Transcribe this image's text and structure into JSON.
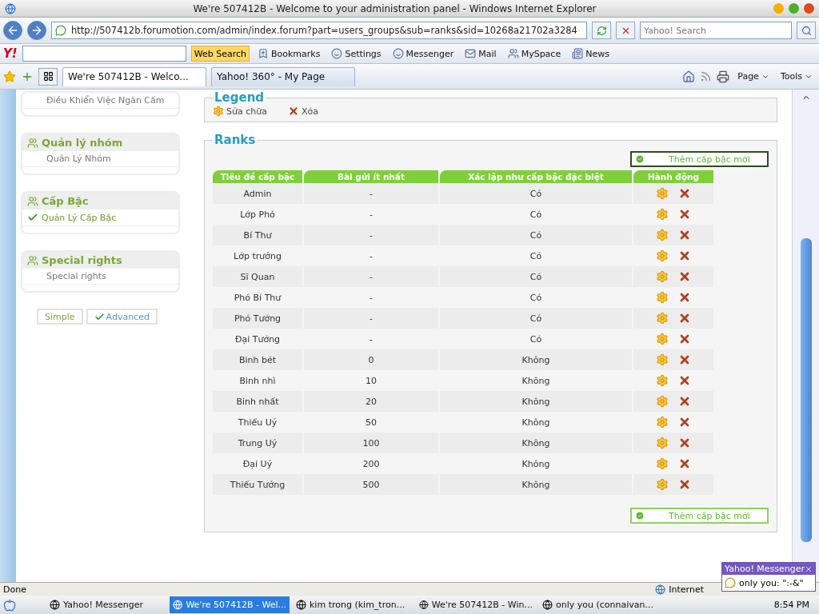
{
  "window": {
    "title": "We're 507412B - Welcome to your administration panel - Windows Internet Explorer"
  },
  "address_bar": {
    "url": "http://507412b.forumotion.com/admin/index.forum?part=users_groups&sub=ranks&sid=10268a21702a3284",
    "search_placeholder": "Yahoo! Search"
  },
  "yahoo_toolbar": {
    "logo": "Y!",
    "search_button": "Web Search",
    "items": [
      "Bookmarks",
      "Settings",
      "Messenger",
      "Mail",
      "MySpace",
      "News"
    ]
  },
  "tabs": [
    {
      "label": "We're 507412B - Welco...",
      "selected": true
    },
    {
      "label": "Yahoo! 360° - My Page",
      "selected": false
    }
  ],
  "command_bar": [
    "Page",
    "Tools"
  ],
  "sidebar": {
    "sections": [
      {
        "items": [
          {
            "label": "Điều Khiển Việc Ngăn Cấm",
            "selected": false
          }
        ]
      },
      {
        "title": "Quản lý nhóm",
        "items": [
          {
            "label": "Quản Lý Nhóm",
            "selected": false
          }
        ]
      },
      {
        "title": "Cấp Bậc",
        "items": [
          {
            "label": "Quản Lý Cấp Bậc",
            "selected": true
          }
        ]
      },
      {
        "title": "Special rights",
        "items": [
          {
            "label": "Special rights",
            "selected": false
          }
        ]
      }
    ],
    "modes": [
      {
        "label": "Simple",
        "selected": false
      },
      {
        "label": "Advanced",
        "selected": true
      }
    ]
  },
  "legend": {
    "title": "Legend",
    "items": [
      {
        "kind": "edit",
        "label": "Sửa chữa"
      },
      {
        "kind": "delete",
        "label": "Xóa"
      }
    ]
  },
  "ranks": {
    "title": "Ranks",
    "add_button": "Thêm cấp bậc mới",
    "columns": [
      "Tiêu đề cấp bậc",
      "Bài gửi ít nhất",
      "Xác lập như cấp bậc đặc biệt",
      "Hành động"
    ],
    "rows": [
      [
        "Admin",
        "-",
        "Có"
      ],
      [
        "Lớp Phó",
        "-",
        "Có"
      ],
      [
        "Bí Thư",
        "-",
        "Có"
      ],
      [
        "Lớp trưởng",
        "-",
        "Có"
      ],
      [
        "Sĩ Quan",
        "-",
        "Có"
      ],
      [
        "Phó Bí Thư",
        "-",
        "Có"
      ],
      [
        "Phó Tướng",
        "-",
        "Có"
      ],
      [
        "Đại Tướng",
        "-",
        "Có"
      ],
      [
        "Binh bét",
        "0",
        "Không"
      ],
      [
        "Binh nhì",
        "10",
        "Không"
      ],
      [
        "Binh nhất",
        "20",
        "Không"
      ],
      [
        "Thiếu Uý",
        "50",
        "Không"
      ],
      [
        "Trung Uý",
        "100",
        "Không"
      ],
      [
        "Đại Uý",
        "200",
        "Không"
      ],
      [
        "Thiếu Tướng",
        "500",
        "Không"
      ]
    ],
    "bottom_add_button": "Thêm cấp bậc mới"
  },
  "status_bar": {
    "text": "Done",
    "zone": "Internet"
  },
  "taskbar": {
    "items": [
      {
        "label": "Yahoo! Messenger",
        "selected": false
      },
      {
        "label": "We're 507412B - Wel...",
        "selected": true
      },
      {
        "label": "kim trong (kim_tron...",
        "selected": false
      },
      {
        "label": "We're 507412B - Win...",
        "selected": false
      },
      {
        "label": "only you (connaivan...",
        "selected": false
      }
    ],
    "clock": "8:54 PM"
  },
  "notification": {
    "title": "Yahoo! Messenger",
    "message": "only you: \":-&\""
  }
}
